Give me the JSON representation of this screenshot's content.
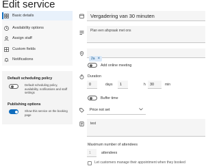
{
  "page": {
    "title": "Edit service"
  },
  "nav": {
    "items": [
      {
        "label": "Basic details",
        "icon": "grid-icon",
        "active": true
      },
      {
        "label": "Availability options",
        "icon": "clock-icon",
        "active": false
      },
      {
        "label": "Assign staff",
        "icon": "person-icon",
        "active": false
      },
      {
        "label": "Custom fields",
        "icon": "grid-list-icon",
        "active": false
      },
      {
        "label": "Notifications",
        "icon": "bell-icon",
        "active": false
      }
    ]
  },
  "settings": {
    "default_policy": {
      "title": "Default scheduling policy",
      "description": "Default scheduling policy, availability, notifications and staff settings",
      "enabled": false
    },
    "publishing": {
      "title": "Publishing options",
      "description": "Show this service on the booking page",
      "enabled": true
    }
  },
  "form": {
    "name": "Vergadering van 30 minuten",
    "description": "Plan een afspraak met ons",
    "location_chip": "2a",
    "online_meeting_label": "Add online meeting",
    "online_meeting_enabled": false,
    "duration": {
      "label": "Duration",
      "days": "0",
      "days_unit": "days",
      "hours": "1",
      "hours_unit": "h",
      "minutes": "30",
      "minutes_unit": "min"
    },
    "buffer_time_label": "Buffer time",
    "buffer_time_enabled": false,
    "price": "Price not set",
    "notes": "test",
    "max_attendees_label": "Maximum number of attendees",
    "attendees_value": "1",
    "attendees_unit": "attendees",
    "partial_checkbox_text": "Let customers manage their appointment when they booked"
  }
}
